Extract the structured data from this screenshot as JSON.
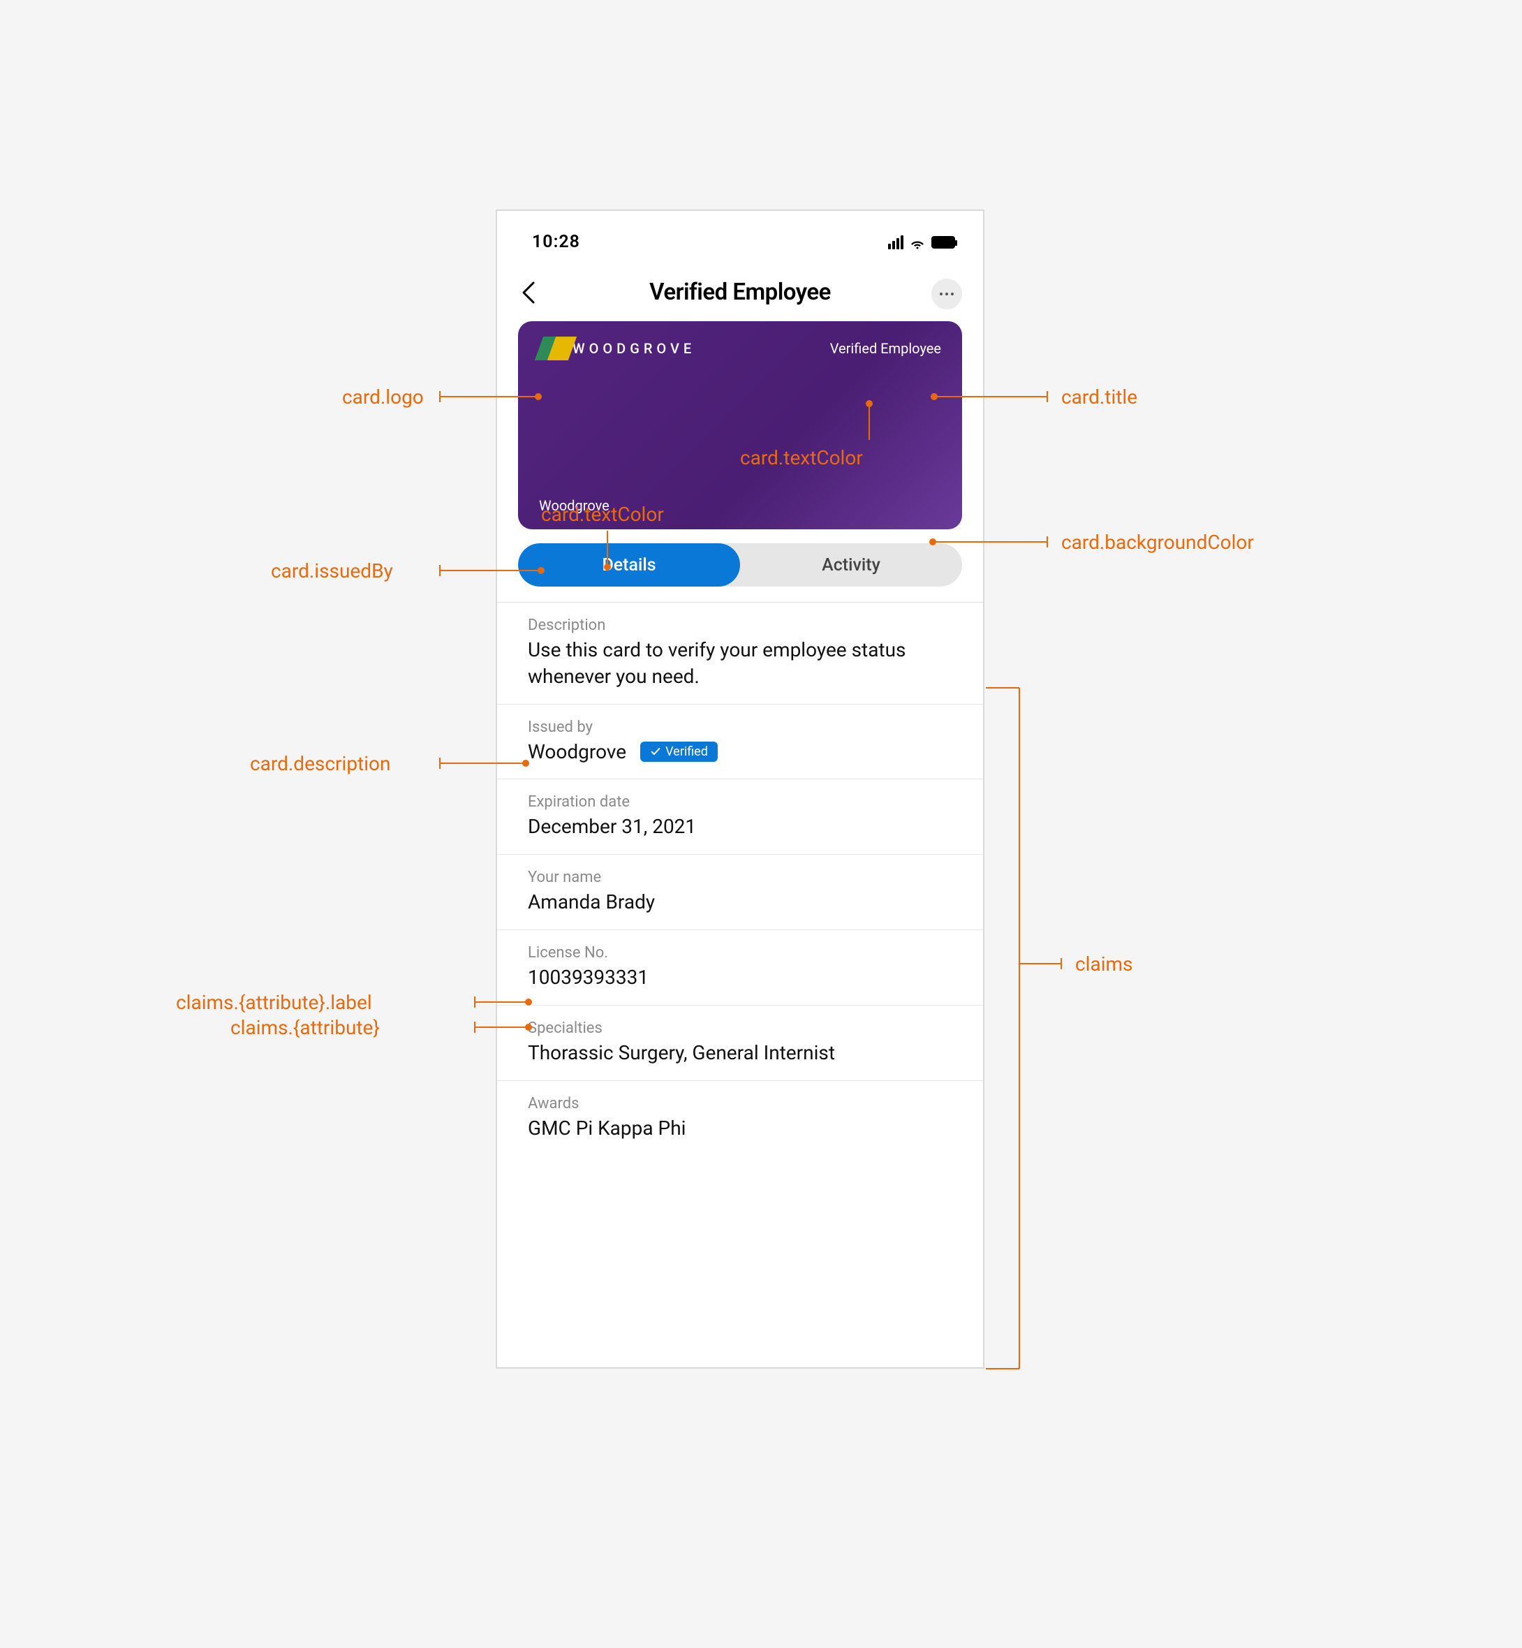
{
  "status": {
    "time": "10:28"
  },
  "nav": {
    "title": "Verified Employee"
  },
  "card": {
    "logoText": "WOODGROVE",
    "title": "Verified Employee",
    "issuedBy": "Woodgrove"
  },
  "tabs": {
    "details": "Details",
    "activity": "Activity"
  },
  "details": {
    "descriptionLabel": "Description",
    "description": "Use this card to verify your employee status whenever you need.",
    "issuedByLabel": "Issued by",
    "issuedBy": "Woodgrove",
    "verifiedBadge": "Verified",
    "expirationLabel": "Expiration date",
    "expiration": "December 31, 2021",
    "nameLabel": "Your name",
    "name": "Amanda Brady",
    "licenseLabel": "License No.",
    "license": "10039393331",
    "specialtiesLabel": "Specialties",
    "specialties": "Thorassic Surgery, General Internist",
    "awardsLabel": "Awards",
    "awards": "GMC Pi Kappa Phi"
  },
  "annotations": {
    "logo": "card.logo",
    "title": "card.title",
    "textColor": "card.textColor",
    "bg": "card.backgroundColor",
    "issuedBy": "card.issuedBy",
    "description": "card.description",
    "claims": "claims",
    "claimLabel": "claims.{attribute}.label",
    "claimValue": "claims.{attribute}"
  }
}
